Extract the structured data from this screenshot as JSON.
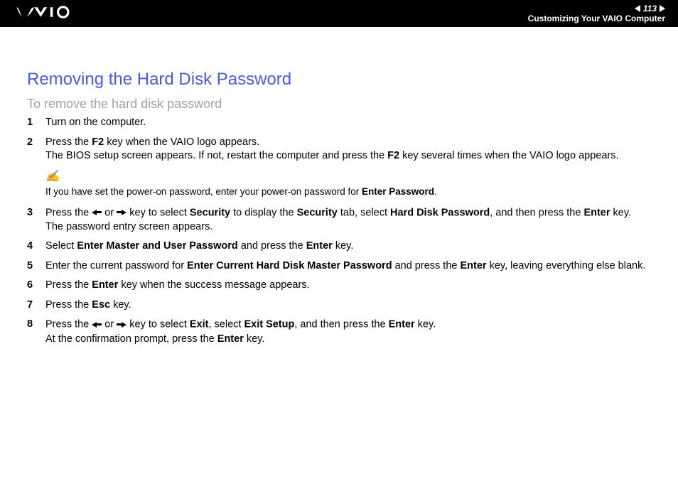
{
  "header": {
    "page_number": "113",
    "section": "Customizing Your VAIO Computer"
  },
  "title": "Removing the Hard Disk Password",
  "subtitle": "To remove the hard disk password",
  "steps": {
    "s1": {
      "num": "1",
      "text": "Turn on the computer."
    },
    "s2": {
      "num": "2",
      "p1a": "Press the ",
      "p1b": "F2",
      "p1c": " key when the VAIO logo appears.",
      "p2a": "The BIOS setup screen appears. If not, restart the computer and press the ",
      "p2b": "F2",
      "p2c": " key several times when the VAIO logo appears."
    },
    "note": {
      "pre": "If you have set the power-on password, enter your power-on password for ",
      "bold": "Enter Password",
      "post": "."
    },
    "s3": {
      "num": "3",
      "a": "Press the ",
      "b": " or ",
      "c": " key to select ",
      "d": "Security",
      "e": " to display the ",
      "f": "Security",
      "g": " tab, select ",
      "h": "Hard Disk Password",
      "i": ", and then press the ",
      "j": "Enter",
      "k": " key.",
      "line2": "The password entry screen appears."
    },
    "s4": {
      "num": "4",
      "a": "Select ",
      "b": "Enter Master and User Password",
      "c": " and press the ",
      "d": "Enter",
      "e": " key."
    },
    "s5": {
      "num": "5",
      "a": "Enter the current password for ",
      "b": "Enter Current Hard Disk Master Password",
      "c": " and press the ",
      "d": "Enter",
      "e": " key, leaving everything else blank."
    },
    "s6": {
      "num": "6",
      "a": "Press the ",
      "b": "Enter",
      "c": " key when the success message appears."
    },
    "s7": {
      "num": "7",
      "a": "Press the ",
      "b": "Esc",
      "c": " key."
    },
    "s8": {
      "num": "8",
      "a": "Press the ",
      "b": " or ",
      "c": " key to select ",
      "d": "Exit",
      "e": ", select ",
      "f": "Exit Setup",
      "g": ", and then press the ",
      "h": "Enter",
      "i": " key.",
      "l2a": "At the confirmation prompt, press the ",
      "l2b": "Enter",
      "l2c": " key."
    }
  }
}
